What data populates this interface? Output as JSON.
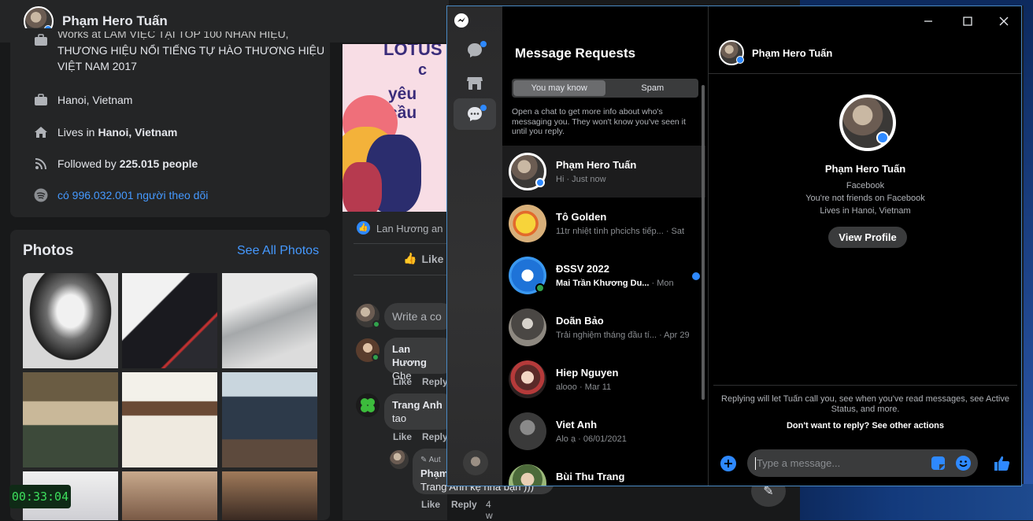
{
  "profile": {
    "name": "Phạm Hero Tuấn",
    "work": "Works at LÀM VIỆC TẠI TOP 100 NHÃN HIỆU, THƯƠNG HIỆU NỔI TIẾNG TỰ HÀO THƯƠNG HIỆU VIỆT NAM 2017",
    "work_line2": "THƯƠNG HIỆU NỔI TIẾNG TỰ HÀO THƯƠNG HIỆU",
    "work_line3": "VIỆT NAM 2017",
    "location": "Hanoi, Vietnam",
    "lives_prefix": "Lives in",
    "lives_in": "Hanoi, Vietnam",
    "followed_prefix": "Followed by",
    "followers": "225.015 people",
    "spotify": "có 996.032.001 người theo dõi"
  },
  "photos": {
    "title": "Photos",
    "see_all": "See All Photos"
  },
  "post": {
    "banner_line1": "LOTUS",
    "banner_line2": "c",
    "banner_line3": "yêu cầu",
    "reactors": "Lan Hương an",
    "like": "Like",
    "write_comment": "Write a co",
    "comments": [
      {
        "author": "Lan Hương",
        "text": "Ghe",
        "like": "Like",
        "reply": "Reply"
      },
      {
        "author": "Trang Anh",
        "text": "tao",
        "like": "Like",
        "reply": "Reply"
      }
    ],
    "reply_badge": "Aut",
    "reply_author": "Phạm",
    "reply_text": "Trang Anh kệ nhà bạn )))",
    "reply_like": "Like",
    "reply_reply": "Reply",
    "reply_time": "4 w"
  },
  "timer": "00:33:04",
  "messenger": {
    "heading": "Message Requests",
    "tabs": [
      "You may know",
      "Spam"
    ],
    "info": "Open a chat to get more info about who's messaging you. They won't know you've seen it until you reply.",
    "conversations": [
      {
        "name": "Phạm Hero Tuấn",
        "snippet": "Hi · Just now",
        "selected": true
      },
      {
        "name": "Tô Golden",
        "snippet": "11tr nhiệt tình phcichs tiếp...",
        "time": "· Sat"
      },
      {
        "name": "ĐSSV 2022",
        "snippet": "Mai Trần Khương Du...",
        "time": "· Mon",
        "unread": true
      },
      {
        "name": "Doãn Bảo",
        "snippet": "Trải nghiệm tháng đầu tí...",
        "time": "· Apr 29"
      },
      {
        "name": "Hiep Nguyen",
        "snippet": "alooo · Mar 11"
      },
      {
        "name": "Viet Anh",
        "snippet": "Alo ạ · 06/01/2021"
      },
      {
        "name": "Bùi Thu Trang",
        "snippet": ""
      }
    ],
    "chat": {
      "header_name": "Phạm Hero Tuấn",
      "profile_name": "Phạm Hero Tuấn",
      "platform": "Facebook",
      "friend_status": "You're not friends on Facebook",
      "lives": "Lives in Hanoi, Vietnam",
      "view_profile": "View Profile",
      "notice": "Replying will let Tuấn call you, see when you've read messages, see Active Status, and more.",
      "other_actions": "Don't want to reply? See other actions",
      "placeholder": "Type a message..."
    },
    "colors": {
      "accent": "#2e89ff",
      "online": "#31a24c"
    }
  }
}
